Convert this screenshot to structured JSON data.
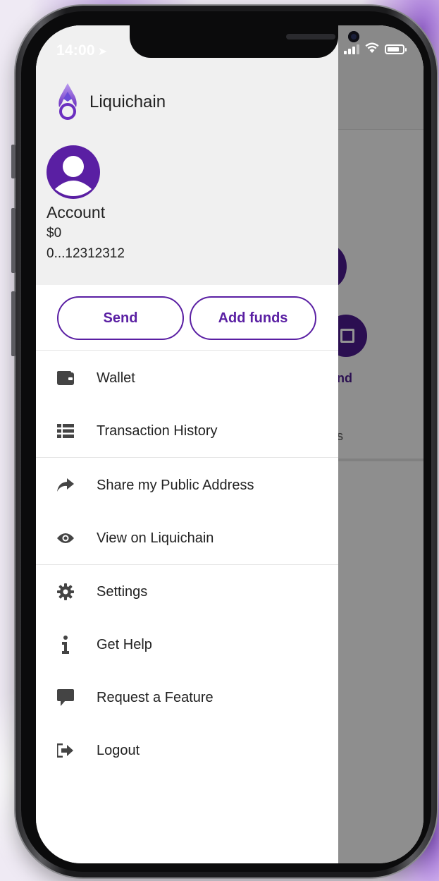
{
  "status_bar": {
    "time": "14:00",
    "location_arrow": "location-arrow-icon"
  },
  "brand": {
    "name": "Liquichain"
  },
  "account": {
    "name": "Account",
    "balance": "$0",
    "address": "0...12312312"
  },
  "actions": {
    "send_label": "Send",
    "add_funds_label": "Add funds"
  },
  "menu": {
    "items": [
      {
        "label": "Wallet",
        "icon": "wallet-icon"
      },
      {
        "label": "Transaction History",
        "icon": "list-icon"
      },
      {
        "label": "Share my Public Address",
        "icon": "share-icon"
      },
      {
        "label": "View on Liquichain",
        "icon": "eye-icon"
      },
      {
        "label": "Settings",
        "icon": "gear-icon"
      },
      {
        "label": "Get Help",
        "icon": "info-icon"
      },
      {
        "label": "Request a Feature",
        "icon": "comment-icon"
      },
      {
        "label": "Logout",
        "icon": "logout-icon"
      }
    ]
  },
  "background_app": {
    "partial_send_label": "nd",
    "partial_tab_label": "s"
  },
  "colors": {
    "accent": "#5a1fa3",
    "drawer_header_bg": "#f0f0f0",
    "text": "#222222"
  }
}
